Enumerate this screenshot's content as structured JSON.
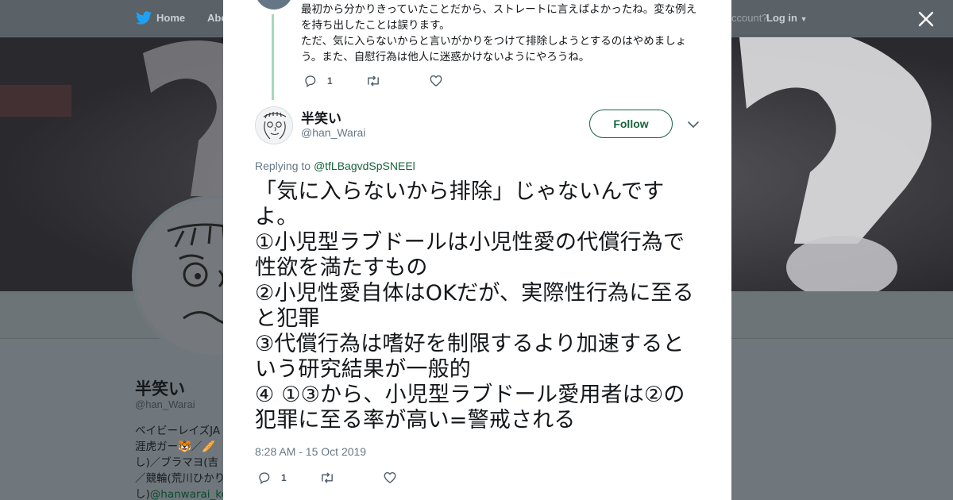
{
  "topbar": {
    "home": "Home",
    "about": "Abo",
    "account_prompt": "ccount?",
    "login": "Log in"
  },
  "profile": {
    "name": "半笑い",
    "handle": "@han_Warai",
    "bio_lines": [
      "ベイビーレイズJA",
      "涯虎ガー🐯／🥖",
      "し)／ブラマヨ(吉",
      "／競輪(荒川ひかり",
      "し)"
    ],
    "bio_link": "@hanwarai_ke"
  },
  "modal": {
    "prev_tweet": {
      "text": "最初から分かりきっていたことだから、ストレートに言えばよかったね。変な例えを持ち出したことは誤ります。\nただ、気に入らないからと言いがかりをつけて排除しようとするのはやめましょう。また、自慰行為は他人に迷惑かけないようにやろうね。",
      "reply_count": "1"
    },
    "tweet": {
      "name": "半笑い",
      "handle": "@han_Warai",
      "follow_label": "Follow",
      "replying_prefix": "Replying to",
      "replying_to": "@tfLBagvdSpSNEEl",
      "text": "「気に入らないから排除」じゃないんですよ。\n①小児型ラブドールは小児性愛の代償行為で性欲を満たすもの\n②小児性愛自体はOKだが、実際性行為に至ると犯罪\n③代償行為は嗜好を制限するより加速するという研究結果が一般的\n④ ①③から、小児型ラブドール愛用者は②の犯罪に至る率が高い=警戒される",
      "timestamp": "8:28 AM - 15 Oct 2019",
      "reply_count": "1"
    }
  },
  "colors": {
    "accent": "#17633d",
    "thread_line": "#a6d8bd",
    "muted": "#657786",
    "twitter_blue": "#1da1f2"
  },
  "icons": [
    "twitter-bird-icon",
    "chevron-down-icon",
    "close-icon",
    "reply-icon",
    "retweet-icon",
    "like-icon"
  ]
}
